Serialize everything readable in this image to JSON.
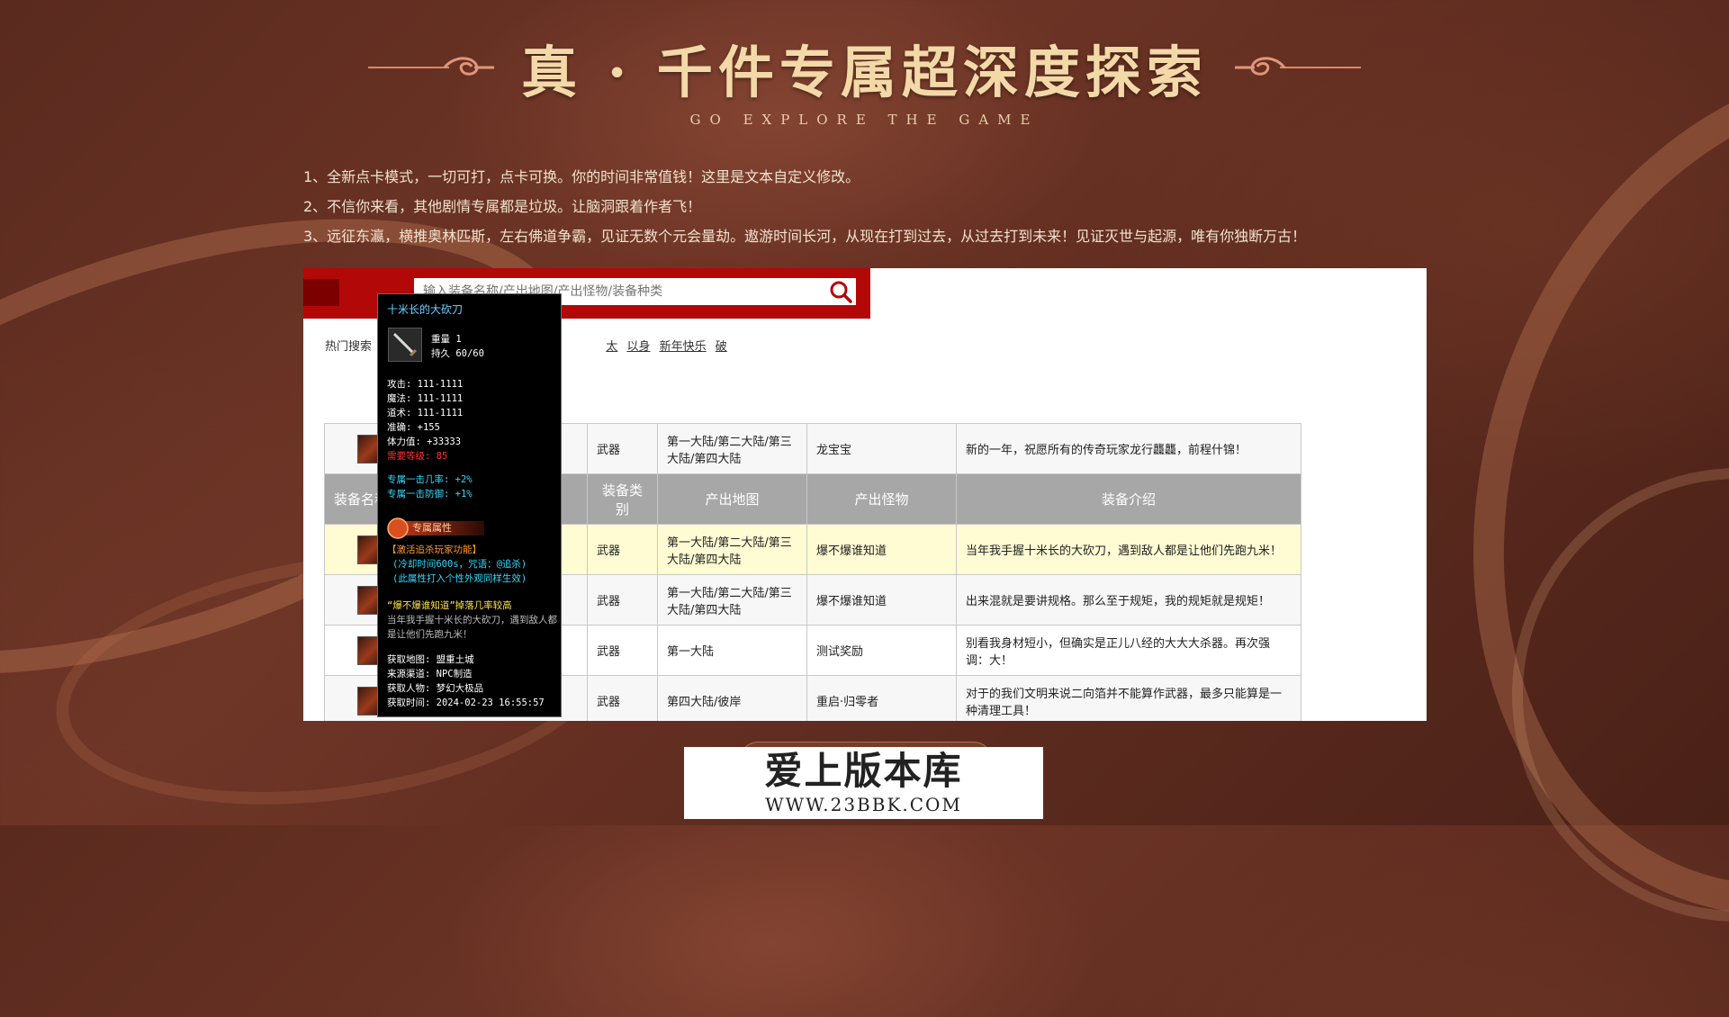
{
  "header": {
    "title": "真 · 千件专属超深度探索",
    "subtitle": "GO EXPLORE THE GAME"
  },
  "intro": [
    "1、全新点卡模式，一切可打，点卡可换。你的时间非常值钱！这里是文本自定义修改。",
    "2、不信你来看，其他剧情专属都是垃圾。让脑洞跟着作者飞！",
    "3、远征东瀛，横推奥林匹斯，左右佛道争霸，见证无数个元会量劫。遨游时间长河，从现在打到过去，从过去打到未来！见证灭世与起源，唯有你独断万古！"
  ],
  "search": {
    "placeholder": "输入装备名称/产出地图/产出怪物/装备种类",
    "icon": "search-icon",
    "hot_label": "热门搜索",
    "hot_terms": [
      "太",
      "以身",
      "新年快乐",
      "破"
    ]
  },
  "table": {
    "headers": [
      "装备名称",
      "装备类别",
      "产出地图",
      "产出怪物",
      "装备介绍"
    ],
    "pinned_row": {
      "category": "武器",
      "map": "第一大陆/第二大陆/第三大陆/第四大陆",
      "monster": "龙宝宝",
      "desc": "新的一年，祝愿所有的传奇玩家龙行龘龘，前程什锦！"
    },
    "rows": [
      {
        "category": "武器",
        "map": "第一大陆/第二大陆/第三大陆/第四大陆",
        "monster": "爆不爆谁知道",
        "desc": "当年我手握十米长的大砍刀，遇到敌人都是让他们先跑九米！"
      },
      {
        "category": "武器",
        "map": "第一大陆/第二大陆/第三大陆/第四大陆",
        "monster": "爆不爆谁知道",
        "desc": "出来混就是要讲规格。那么至于规矩，我的规矩就是规矩！"
      },
      {
        "category": "武器",
        "map": "第一大陆",
        "monster": "测试奖励",
        "desc": "别看我身材短小，但确实是正儿八经的大大大杀器。再次强调：大！"
      },
      {
        "category": "武器",
        "map": "第四大陆/彼岸",
        "monster": "重启·归零者",
        "desc": "对于的我们文明来说二向箔并不能算作武器，最多只能算是一种清理工具！"
      }
    ]
  },
  "tooltip": {
    "name": "十米长的大砍刀",
    "weight": "重量 1",
    "durability": "持久 60/60",
    "stats": [
      "攻击: 111-1111",
      "魔法: 111-1111",
      "道术: 111-1111",
      "准确: +155",
      "体力值: +33333"
    ],
    "requirement": "需要等级: 85",
    "exclusive": [
      "专属一击几率: +2%",
      "专属一击防御: +1%"
    ],
    "badge_label": "专属属性",
    "skill_title": "【激活追杀玩家功能】",
    "skill_lines": [
      "(冷却时间600s，咒语：@追杀)",
      "(此属性打入个性外观同样生效)"
    ],
    "drop_title": "“爆不爆谁知道”掉落几率较高",
    "drop_desc": "当年我手握十米长的大砍刀，遇到敌人都是让他们先跑九米！",
    "obtain": [
      "获取地图: 盟重土城",
      "来源渠道: NPC制造",
      "获取人物: 梦幻大极品",
      "获取时间: 2024-02-23 16:55:57"
    ]
  },
  "watermark": {
    "title": "爱上版本库",
    "url": "WWW.23BBK.COM"
  },
  "colors": {
    "accent_red": "#b30808",
    "title_gold": "#f3d9a8",
    "row_highlight": "#fffbd2",
    "header_gray": "#a7a7a7"
  }
}
